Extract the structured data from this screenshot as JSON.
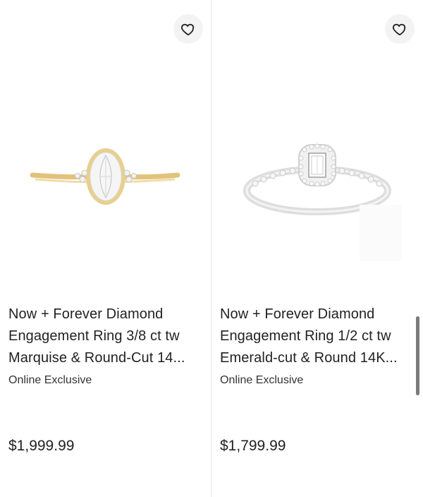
{
  "products": [
    {
      "title": "Now + Forever Diamond Engagement Ring 3/8 ct tw Marquise & Round-Cut 14...",
      "badge": "Online Exclusive",
      "price": "$1,999.99",
      "image_icon": "ring-yellow-gold-marquise",
      "metal_color": "#e2c27a"
    },
    {
      "title": "Now + Forever Diamond Engagement Ring 1/2 ct tw Emerald-cut & Round 14K...",
      "badge": "Online Exclusive",
      "price": "$1,799.99",
      "image_icon": "ring-white-gold-emerald",
      "metal_color": "#dcdcdc"
    }
  ],
  "icons": {
    "wishlist": "heart-icon"
  }
}
